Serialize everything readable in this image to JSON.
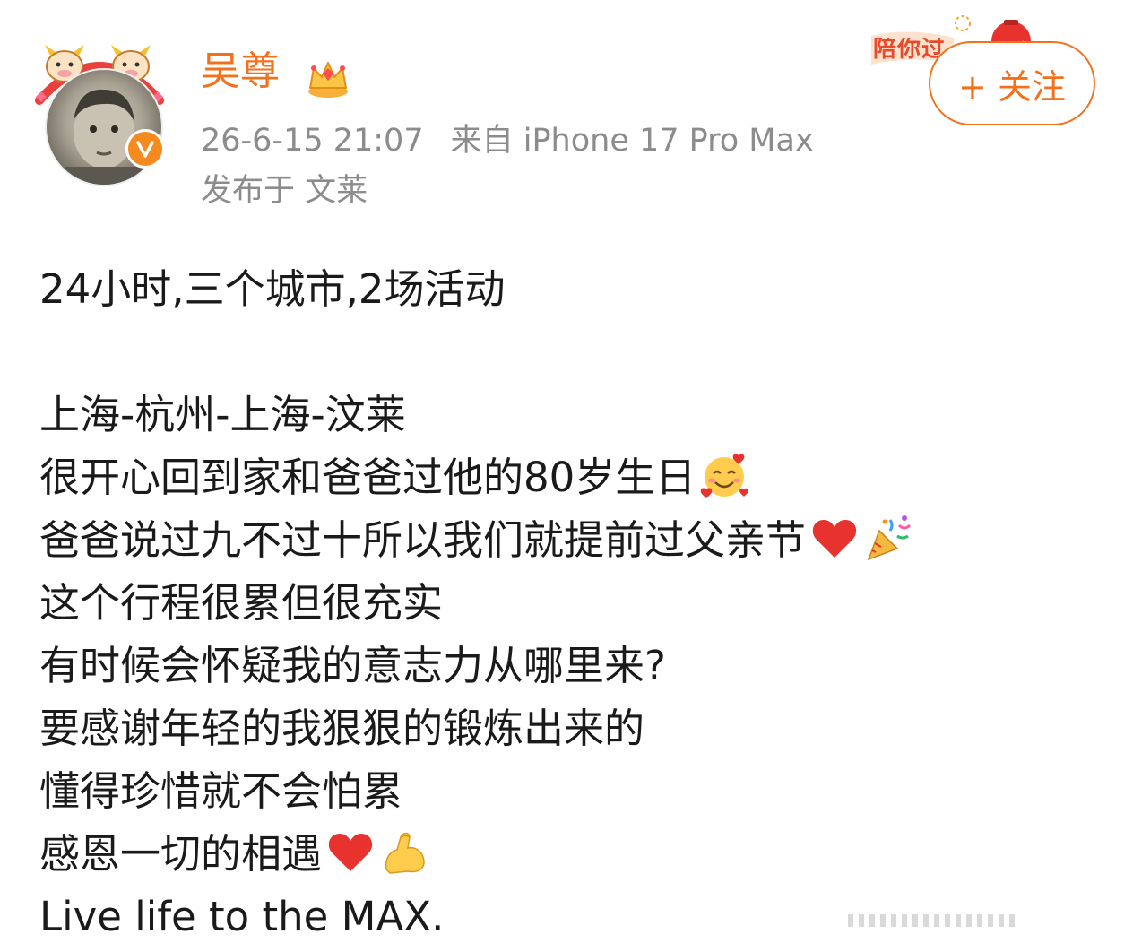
{
  "header": {
    "username": "吴尊",
    "timestamp": "26-6-15 21:07",
    "source": "来自 iPhone 17 Pro Max",
    "location": "发布于 文莱",
    "festival_badge": "陪你过",
    "follow_label": "+ 关注"
  },
  "icons": {
    "badge": "verified-v-icon",
    "crown": "crown-icon",
    "emoji_1": "smiling-face-with-hearts",
    "emoji_2": "red-heart",
    "emoji_3": "party-popper",
    "emoji_4": "flexed-biceps"
  },
  "colors": {
    "accent": "#f2711c",
    "meta_text": "#8c8c8c",
    "body_text": "#1a1a1a"
  },
  "post": {
    "lines": [
      "24小时,三个城市,2场活动",
      "",
      "上海-杭州-上海-汶莱",
      "很开心回到家和爸爸过他的80岁生日",
      "爸爸说过九不过十所以我们就提前过父亲节",
      "这个行程很累但很充实",
      "有时候会怀疑我的意志力从哪里来?",
      "要感谢年轻的我狠狠的锻炼出来的",
      "懂得珍惜就不会怕累",
      "感恩一切的相遇",
      "Live life to the MAX."
    ]
  }
}
